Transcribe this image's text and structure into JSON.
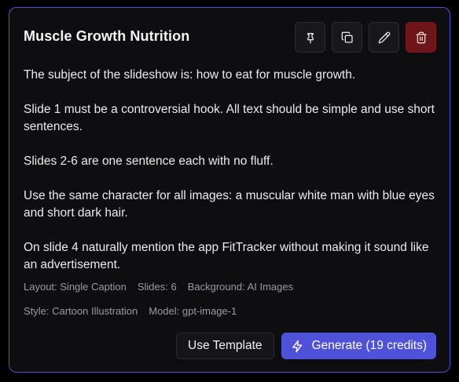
{
  "template": {
    "title": "Muscle Growth Nutrition",
    "prompt_paragraphs": [
      "The subject of the slideshow is: how to eat for muscle growth.",
      "Slide 1 must be a controversial hook. All text should be simple and use short sentences.",
      "Slides 2-6 are one sentence each with no fluff.",
      "Use the same character for all images: a muscular white man with blue eyes and short dark hair.",
      "On slide 4 naturally mention the app FitTracker without making it sound like an advertisement."
    ],
    "meta": {
      "layout": "Layout: Single Caption",
      "slides": "Slides: 6",
      "background": "Background: AI Images",
      "style": "Style: Cartoon Illustration",
      "model": "Model: gpt-image-1"
    }
  },
  "actions": {
    "pin_icon": "pin-icon",
    "copy_icon": "copy-icon",
    "edit_icon": "pencil-icon",
    "delete_icon": "trash-icon"
  },
  "buttons": {
    "use_template": "Use Template",
    "generate": "Generate (19 credits)",
    "generate_icon": "lightning-icon"
  },
  "colors": {
    "accent": "#4f52d9",
    "border_accent": "#4a4fd6",
    "danger": "#6e1519",
    "card_bg": "#0e0e10"
  }
}
